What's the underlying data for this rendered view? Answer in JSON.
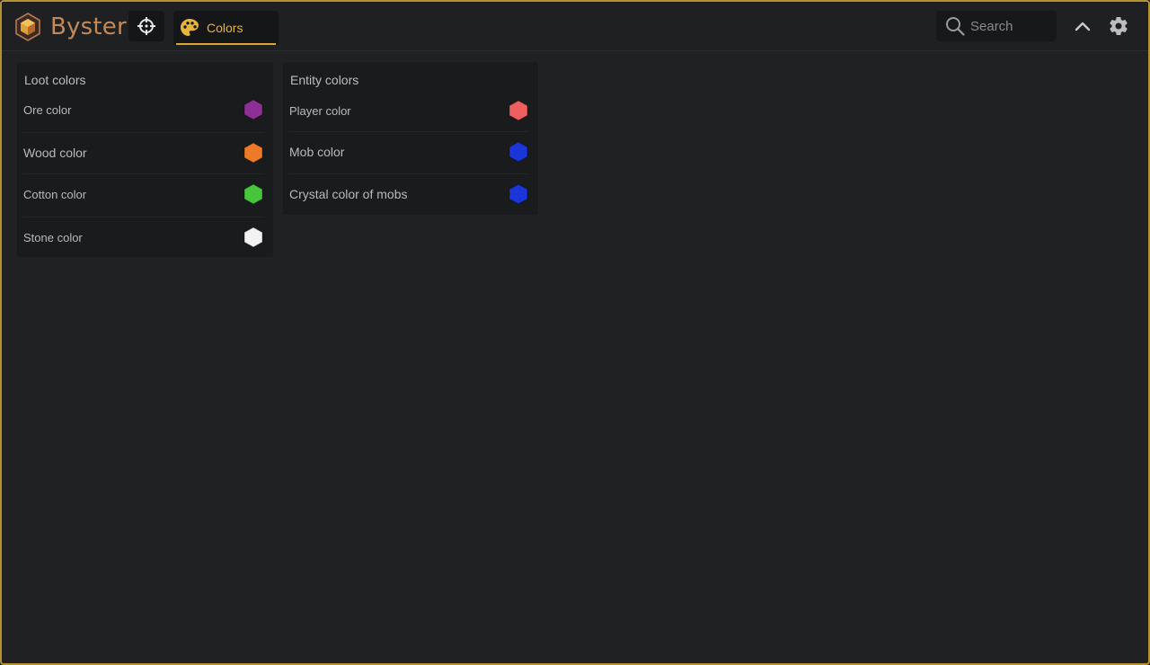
{
  "app": {
    "name": "Byster"
  },
  "tabs": [
    {
      "id": "crosshair",
      "icon": "crosshair-icon"
    },
    {
      "id": "colors",
      "label": "Colors",
      "icon": "palette-icon",
      "active": true
    }
  ],
  "search": {
    "placeholder": "Search"
  },
  "accent": "#dba632",
  "panels": {
    "loot": {
      "title": "Loot colors",
      "items": [
        {
          "label": "Ore color",
          "color": "#8e2f96"
        },
        {
          "label": "Wood color",
          "color": "#ee7a28"
        },
        {
          "label": "Cotton color",
          "color": "#47c63c"
        },
        {
          "label": "Stone color",
          "color": "#f2f2f2"
        }
      ]
    },
    "entity": {
      "title": "Entity colors",
      "items": [
        {
          "label": "Player color",
          "color": "#ef5f5f"
        },
        {
          "label": "Mob color",
          "color": "#1a36d8"
        },
        {
          "label": "Crystal color of mobs",
          "color": "#1a36d8"
        }
      ]
    }
  }
}
